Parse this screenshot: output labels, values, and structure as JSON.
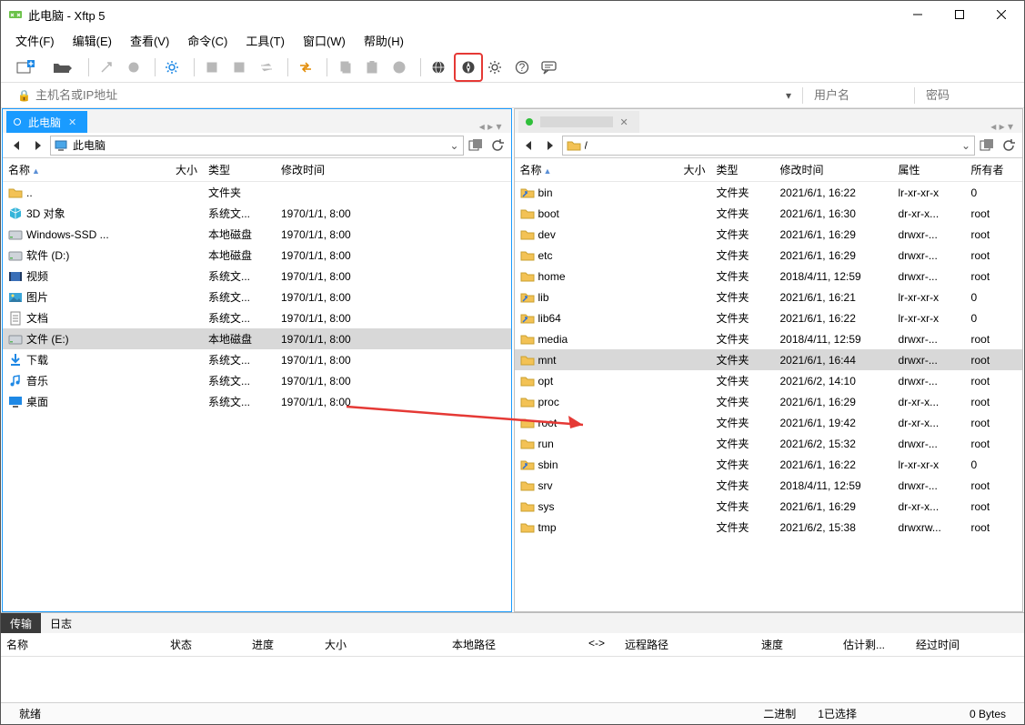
{
  "window": {
    "title": "此电脑 - Xftp 5"
  },
  "menu": [
    "文件(F)",
    "编辑(E)",
    "查看(V)",
    "命令(C)",
    "工具(T)",
    "窗口(W)",
    "帮助(H)"
  ],
  "addressbar": {
    "host_placeholder": "主机名或IP地址",
    "user_placeholder": "用户名",
    "pass_placeholder": "密码"
  },
  "left": {
    "tab_label": "此电脑",
    "path": "此电脑",
    "columns": [
      "名称",
      "大小",
      "类型",
      "修改时间"
    ],
    "rows": [
      {
        "icon": "folder",
        "name": "..",
        "type": "文件夹",
        "mtime": ""
      },
      {
        "icon": "obj3d",
        "name": "3D 对象",
        "type": "系统文...",
        "mtime": "1970/1/1, 8:00"
      },
      {
        "icon": "disk",
        "name": "Windows-SSD ...",
        "type": "本地磁盘",
        "mtime": "1970/1/1, 8:00"
      },
      {
        "icon": "disk",
        "name": "软件 (D:)",
        "type": "本地磁盘",
        "mtime": "1970/1/1, 8:00"
      },
      {
        "icon": "video",
        "name": "视频",
        "type": "系统文...",
        "mtime": "1970/1/1, 8:00"
      },
      {
        "icon": "image",
        "name": "图片",
        "type": "系统文...",
        "mtime": "1970/1/1, 8:00"
      },
      {
        "icon": "doc",
        "name": "文档",
        "type": "系统文...",
        "mtime": "1970/1/1, 8:00"
      },
      {
        "icon": "disk",
        "name": "文件 (E:)",
        "type": "本地磁盘",
        "mtime": "1970/1/1, 8:00",
        "selected": true
      },
      {
        "icon": "download",
        "name": "下载",
        "type": "系统文...",
        "mtime": "1970/1/1, 8:00"
      },
      {
        "icon": "music",
        "name": "音乐",
        "type": "系统文...",
        "mtime": "1970/1/1, 8:00"
      },
      {
        "icon": "desktop",
        "name": "桌面",
        "type": "系统文...",
        "mtime": "1970/1/1, 8:00"
      }
    ]
  },
  "right": {
    "tab_label": "",
    "path": "/",
    "columns": [
      "名称",
      "大小",
      "类型",
      "修改时间",
      "属性",
      "所有者"
    ],
    "rows": [
      {
        "icon": "link",
        "name": "bin",
        "type": "文件夹",
        "mtime": "2021/6/1, 16:22",
        "perm": "lr-xr-xr-x",
        "owner": "0"
      },
      {
        "icon": "folder",
        "name": "boot",
        "type": "文件夹",
        "mtime": "2021/6/1, 16:30",
        "perm": "dr-xr-x...",
        "owner": "root"
      },
      {
        "icon": "folder",
        "name": "dev",
        "type": "文件夹",
        "mtime": "2021/6/1, 16:29",
        "perm": "drwxr-...",
        "owner": "root"
      },
      {
        "icon": "folder",
        "name": "etc",
        "type": "文件夹",
        "mtime": "2021/6/1, 16:29",
        "perm": "drwxr-...",
        "owner": "root"
      },
      {
        "icon": "folder",
        "name": "home",
        "type": "文件夹",
        "mtime": "2018/4/11, 12:59",
        "perm": "drwxr-...",
        "owner": "root"
      },
      {
        "icon": "link",
        "name": "lib",
        "type": "文件夹",
        "mtime": "2021/6/1, 16:21",
        "perm": "lr-xr-xr-x",
        "owner": "0"
      },
      {
        "icon": "link",
        "name": "lib64",
        "type": "文件夹",
        "mtime": "2021/6/1, 16:22",
        "perm": "lr-xr-xr-x",
        "owner": "0"
      },
      {
        "icon": "folder",
        "name": "media",
        "type": "文件夹",
        "mtime": "2018/4/11, 12:59",
        "perm": "drwxr-...",
        "owner": "root"
      },
      {
        "icon": "folder",
        "name": "mnt",
        "type": "文件夹",
        "mtime": "2021/6/1, 16:44",
        "perm": "drwxr-...",
        "owner": "root",
        "selected": true
      },
      {
        "icon": "folder",
        "name": "opt",
        "type": "文件夹",
        "mtime": "2021/6/2, 14:10",
        "perm": "drwxr-...",
        "owner": "root"
      },
      {
        "icon": "folder",
        "name": "proc",
        "type": "文件夹",
        "mtime": "2021/6/1, 16:29",
        "perm": "dr-xr-x...",
        "owner": "root"
      },
      {
        "icon": "folder",
        "name": "root",
        "type": "文件夹",
        "mtime": "2021/6/1, 19:42",
        "perm": "dr-xr-x...",
        "owner": "root"
      },
      {
        "icon": "folder",
        "name": "run",
        "type": "文件夹",
        "mtime": "2021/6/2, 15:32",
        "perm": "drwxr-...",
        "owner": "root"
      },
      {
        "icon": "link",
        "name": "sbin",
        "type": "文件夹",
        "mtime": "2021/6/1, 16:22",
        "perm": "lr-xr-xr-x",
        "owner": "0"
      },
      {
        "icon": "folder",
        "name": "srv",
        "type": "文件夹",
        "mtime": "2018/4/11, 12:59",
        "perm": "drwxr-...",
        "owner": "root"
      },
      {
        "icon": "folder",
        "name": "sys",
        "type": "文件夹",
        "mtime": "2021/6/1, 16:29",
        "perm": "dr-xr-x...",
        "owner": "root"
      },
      {
        "icon": "folder",
        "name": "tmp",
        "type": "文件夹",
        "mtime": "2021/6/2, 15:38",
        "perm": "drwxrw...",
        "owner": "root"
      }
    ]
  },
  "transfer": {
    "tabs": [
      "传输",
      "日志"
    ],
    "columns": [
      "名称",
      "状态",
      "进度",
      "大小",
      "本地路径",
      "<->",
      "远程路径",
      "速度",
      "估计剩...",
      "经过时间"
    ]
  },
  "status": {
    "ready": "就绪",
    "mode": "二进制",
    "selected": "1已选择",
    "bytes": "0 Bytes"
  }
}
